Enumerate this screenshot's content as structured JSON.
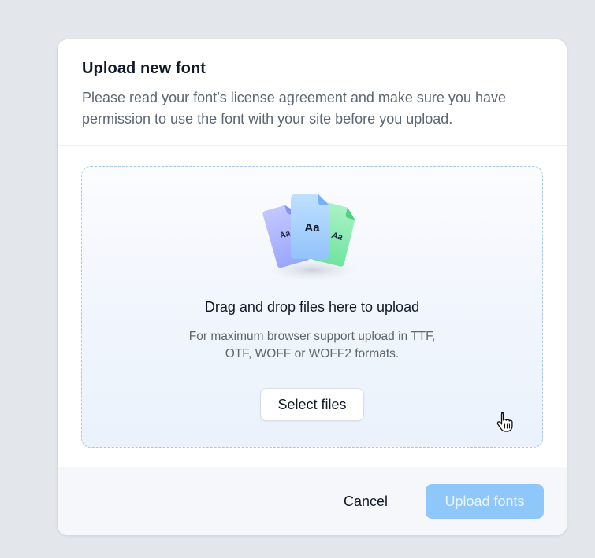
{
  "modal": {
    "title": "Upload new font",
    "description": "Please read your font’s license agreement and make sure you have permission to use the font with your site before you upload."
  },
  "dropzone": {
    "title": "Drag and drop files here to upload",
    "hint": "For maximum browser support upload in TTF, OTF, WOFF or WOFF2 formats.",
    "file_glyph_left": "Aa",
    "file_glyph_center": "Aa",
    "file_glyph_right": "Aa",
    "select_button_label": "Select files"
  },
  "footer": {
    "cancel_label": "Cancel",
    "upload_label": "Upload fonts",
    "upload_enabled": false
  },
  "icons": {
    "illustration": "font-files-icon",
    "cursor": "hand-pointer-icon"
  },
  "colors": {
    "accent": "#8ec8fb",
    "file_purple": "#a5b4fc",
    "file_blue": "#93c5fd",
    "file_green": "#86efac",
    "dropzone_border": "#a9c7e4"
  }
}
